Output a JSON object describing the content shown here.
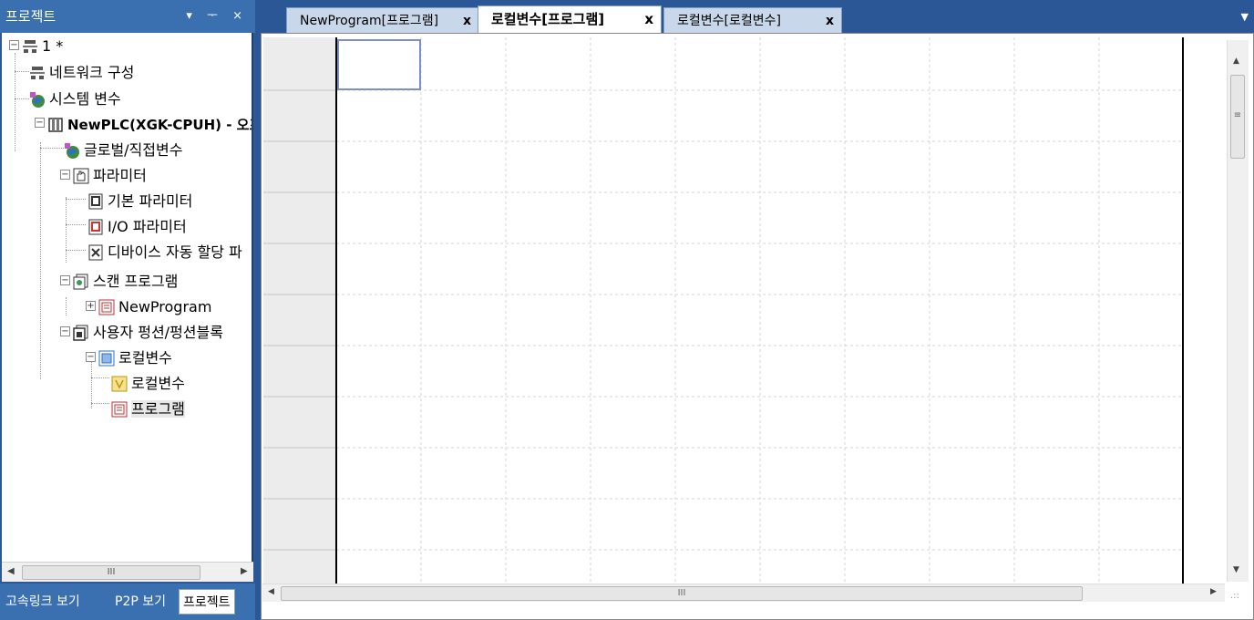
{
  "project_panel": {
    "title": "프로젝트",
    "header_buttons": "▾ ᅮ ×",
    "tree": {
      "root": "1 *",
      "network": "네트워크 구성",
      "system_vars": "시스템 변수",
      "plc": "NewPLC(XGK-CPUH) - 오프라",
      "global_vars": "글로벌/직접변수",
      "params": "파라미터",
      "basic_params": "기본 파라미터",
      "io_params": "I/O 파라미터",
      "device_params": "디바이스 자동 할당 파",
      "scan_program": "스캔 프로그램",
      "new_program": "NewProgram",
      "user_fb": "사용자 펑션/펑션블록",
      "local_vars": "로컬변수",
      "local_vars_child": "로컬변수",
      "program": "프로그램"
    },
    "scroll_grip": "III",
    "bottom_tabs": [
      "고속링크 보기",
      "P2P 보기",
      "프로젝트"
    ]
  },
  "editor": {
    "tabs": [
      {
        "label": "NewProgram[프로그램]",
        "close": "x"
      },
      {
        "label": "로컬변수[프로그램]",
        "close": "x"
      },
      {
        "label": "로컬변수[로컬변수]",
        "close": "x"
      }
    ],
    "active_tab": 1,
    "dropdown": "▼",
    "scroll_grip": "III",
    "vscroll_grip": "≡"
  },
  "colors": {
    "chrome": "#2b5797",
    "grid_line": "#d6d6d6",
    "cursor": "#7b8fc8"
  }
}
